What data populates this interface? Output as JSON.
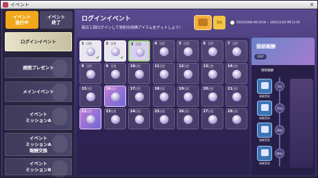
{
  "window": {
    "title": "イベント",
    "close": "×"
  },
  "tabs": {
    "active": "イベント\n進行中",
    "inactive": "イベント\n終了"
  },
  "sidebar": {
    "items": [
      {
        "label": "ログインイベント"
      },
      {
        "label": "週間プレゼント"
      },
      {
        "label": "メインイベント"
      },
      {
        "label": "イベント\nミッションA"
      },
      {
        "label": "イベント\nミッションA\n報酬交換"
      },
      {
        "label": "イベント\nミッションB"
      }
    ]
  },
  "main": {
    "title": "ログインイベント",
    "subtitle": "毎日１回ログインして特別な特典アイテムをゲットしよう！",
    "reward_button": "受取",
    "period": "2022/10/08 AM 10:00 ~ 2022/11/02 PM 11:59",
    "day_suffix": "日目",
    "days": [
      {
        "n": "1",
        "state": "done"
      },
      {
        "n": "2",
        "state": "done"
      },
      {
        "n": "3",
        "state": "today"
      },
      {
        "n": "4",
        "state": "locked"
      },
      {
        "n": "5",
        "state": "locked"
      },
      {
        "n": "6",
        "state": "locked"
      },
      {
        "n": "7",
        "state": "locked"
      },
      {
        "n": "8",
        "state": "locked"
      },
      {
        "n": "9",
        "state": "locked"
      },
      {
        "n": "10",
        "state": "locked"
      },
      {
        "n": "11",
        "state": "locked"
      },
      {
        "n": "12",
        "state": "locked"
      },
      {
        "n": "13",
        "state": "locked"
      },
      {
        "n": "14",
        "state": "locked"
      },
      {
        "n": "15",
        "state": "locked"
      },
      {
        "n": "16",
        "state": "special"
      },
      {
        "n": "17",
        "state": "locked"
      },
      {
        "n": "18",
        "state": "locked"
      },
      {
        "n": "19",
        "state": "locked"
      },
      {
        "n": "20",
        "state": "locked"
      },
      {
        "n": "21",
        "state": "locked"
      },
      {
        "n": "22",
        "state": "special"
      },
      {
        "n": "23",
        "state": "locked"
      },
      {
        "n": "24",
        "state": "locked"
      },
      {
        "n": "25",
        "state": "locked"
      },
      {
        "n": "26",
        "state": "locked"
      },
      {
        "n": "27",
        "state": "locked"
      },
      {
        "n": "28",
        "state": "locked"
      }
    ]
  },
  "side": {
    "title": "接続報酬",
    "badge": "1037",
    "subtitle": "接続報酬",
    "slots": [
      {
        "label": "報酬受取",
        "time": "5分"
      },
      {
        "label": "報酬受取",
        "time": "15分"
      },
      {
        "label": "報酬受取",
        "time": "30分"
      },
      {
        "label": "報酬受取",
        "time": "60分"
      }
    ]
  }
}
